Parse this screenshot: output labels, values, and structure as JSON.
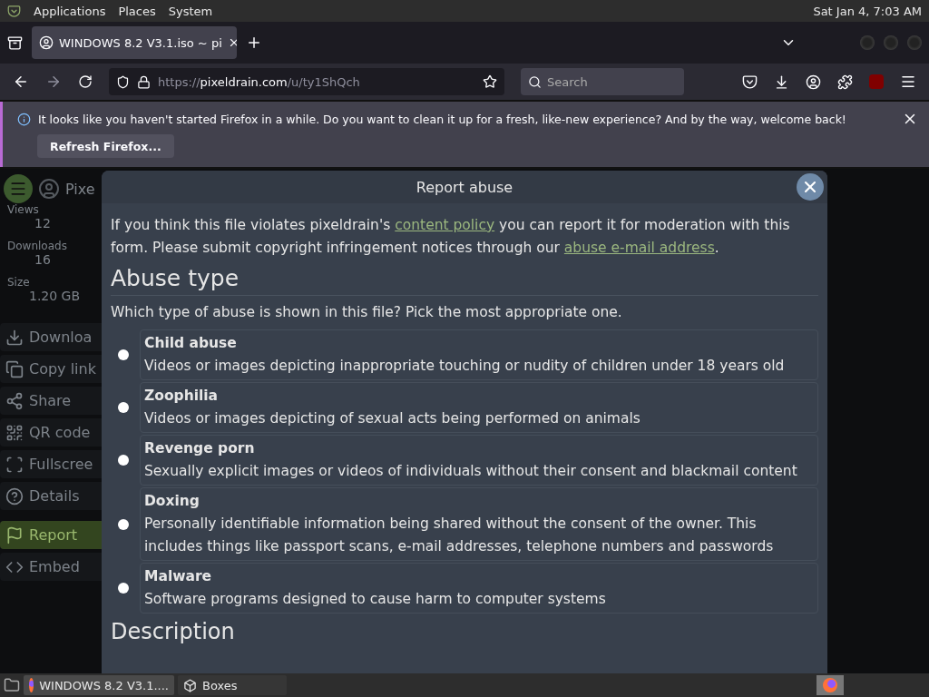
{
  "top_panel": {
    "menus": [
      "Applications",
      "Places",
      "System"
    ],
    "clock": "Sat Jan  4,  7:03 AM"
  },
  "browser": {
    "tab": {
      "title": "WINDOWS 8.2 V3.1.iso ~ pi",
      "selected": true
    },
    "address": {
      "prefix": "https://",
      "host": "pixeldrain.com",
      "path": "/u/ty1ShQch"
    },
    "search": {
      "placeholder": "Search"
    },
    "notification": {
      "message": "It looks like you haven't started Firefox in a while. Do you want to clean it up for a fresh, like-new experience? And by the way, welcome back!",
      "button": "Refresh Firefox..."
    }
  },
  "sidebar": {
    "brand": "Pixe",
    "stats": [
      {
        "label": "Views",
        "value": "12"
      },
      {
        "label": "Downloads",
        "value": "16"
      },
      {
        "label": "Size",
        "value": "1.20 GB"
      }
    ],
    "items": [
      {
        "label": "Downloa",
        "selected": false
      },
      {
        "label": "Copy link",
        "selected": false
      },
      {
        "label": "Share",
        "selected": false
      },
      {
        "label": "QR code",
        "selected": false
      },
      {
        "label": "Fullscree",
        "selected": false
      },
      {
        "label": "Details",
        "selected": false
      },
      {
        "label": "Report",
        "selected": true
      },
      {
        "label": "Embed",
        "selected": false
      }
    ]
  },
  "dialog": {
    "title": "Report abuse",
    "intro": [
      {
        "kind": "text",
        "text": "If you think this file violates pixeldrain's "
      },
      {
        "kind": "link",
        "text": "content policy"
      },
      {
        "kind": "text",
        "text": " you can report it for moderation with this form. Please submit copyright infringement notices through our "
      },
      {
        "kind": "link",
        "text": "abuse e-mail address"
      },
      {
        "kind": "text",
        "text": "."
      }
    ],
    "heading": "Abuse type",
    "question": "Which type of abuse is shown in this file? Pick the most appropriate one.",
    "options": [
      {
        "title": "Child abuse",
        "description": "Videos or images depicting inappropriate touching or nudity of children under 18 years old",
        "selected": false
      },
      {
        "title": "Zoophilia",
        "description": "Videos or images depicting of sexual acts being performed on animals",
        "selected": false
      },
      {
        "title": "Revenge porn",
        "description": "Sexually explicit images or videos of individuals without their consent and blackmail content",
        "selected": false
      },
      {
        "title": "Doxing",
        "description": "Personally identifiable information being shared without the consent of the owner. This includes things like passport scans, e-mail addresses, telephone numbers and passwords",
        "selected": false
      },
      {
        "title": "Malware",
        "description": "Software programs designed to cause harm to computer systems",
        "selected": false
      }
    ],
    "next_heading": "Description"
  },
  "taskbar": {
    "windows": [
      {
        "title": "WINDOWS 8.2 V3.1....",
        "selected": true
      },
      {
        "title": "Boxes",
        "selected": false
      }
    ]
  }
}
